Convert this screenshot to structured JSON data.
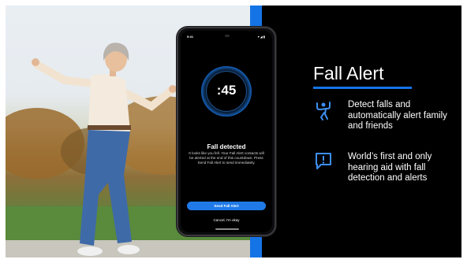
{
  "phone": {
    "status_time": "9:41",
    "status_icons": "▾◢▮",
    "countdown": ":45",
    "alert_title": "Fall detected",
    "alert_body": "It looks like you fell. Your Fall Alert contacts will be alerted at the end of this countdown. Press Send Fall Alert to send immediately.",
    "send_button": "Send Fall Alert",
    "cancel_button": "Cancel, I'm okay"
  },
  "slide": {
    "title": "Fall Alert",
    "features": [
      {
        "icon": "falling-person-icon",
        "text": "Detect falls and automatically alert family and friends"
      },
      {
        "icon": "exclamation-alert-icon",
        "text": "World’s first and only hearing aid with fall detection and alerts"
      }
    ]
  },
  "colors": {
    "accent": "#1474e6",
    "background": "#000000",
    "button": "#1f7ae8"
  }
}
